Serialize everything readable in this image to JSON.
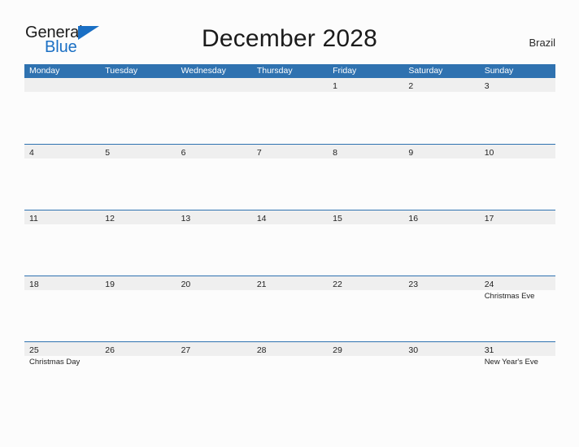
{
  "brand": {
    "name_part1": "General",
    "name_part2": "Blue",
    "flag_icon": "blue-triangle-flag"
  },
  "header": {
    "title": "December 2028",
    "region": "Brazil"
  },
  "calendar": {
    "weekdays": [
      "Monday",
      "Tuesday",
      "Wednesday",
      "Thursday",
      "Friday",
      "Saturday",
      "Sunday"
    ],
    "accent_color": "#2f72b0",
    "date_strip_color": "#efefef",
    "weeks": [
      [
        {
          "date": ""
        },
        {
          "date": ""
        },
        {
          "date": ""
        },
        {
          "date": ""
        },
        {
          "date": "1"
        },
        {
          "date": "2"
        },
        {
          "date": "3"
        }
      ],
      [
        {
          "date": "4"
        },
        {
          "date": "5"
        },
        {
          "date": "6"
        },
        {
          "date": "7"
        },
        {
          "date": "8"
        },
        {
          "date": "9"
        },
        {
          "date": "10"
        }
      ],
      [
        {
          "date": "11"
        },
        {
          "date": "12"
        },
        {
          "date": "13"
        },
        {
          "date": "14"
        },
        {
          "date": "15"
        },
        {
          "date": "16"
        },
        {
          "date": "17"
        }
      ],
      [
        {
          "date": "18"
        },
        {
          "date": "19"
        },
        {
          "date": "20"
        },
        {
          "date": "21"
        },
        {
          "date": "22"
        },
        {
          "date": "23"
        },
        {
          "date": "24",
          "event": "Christmas Eve"
        }
      ],
      [
        {
          "date": "25",
          "event": "Christmas Day"
        },
        {
          "date": "26"
        },
        {
          "date": "27"
        },
        {
          "date": "28"
        },
        {
          "date": "29"
        },
        {
          "date": "30"
        },
        {
          "date": "31",
          "event": "New Year's Eve"
        }
      ]
    ]
  }
}
